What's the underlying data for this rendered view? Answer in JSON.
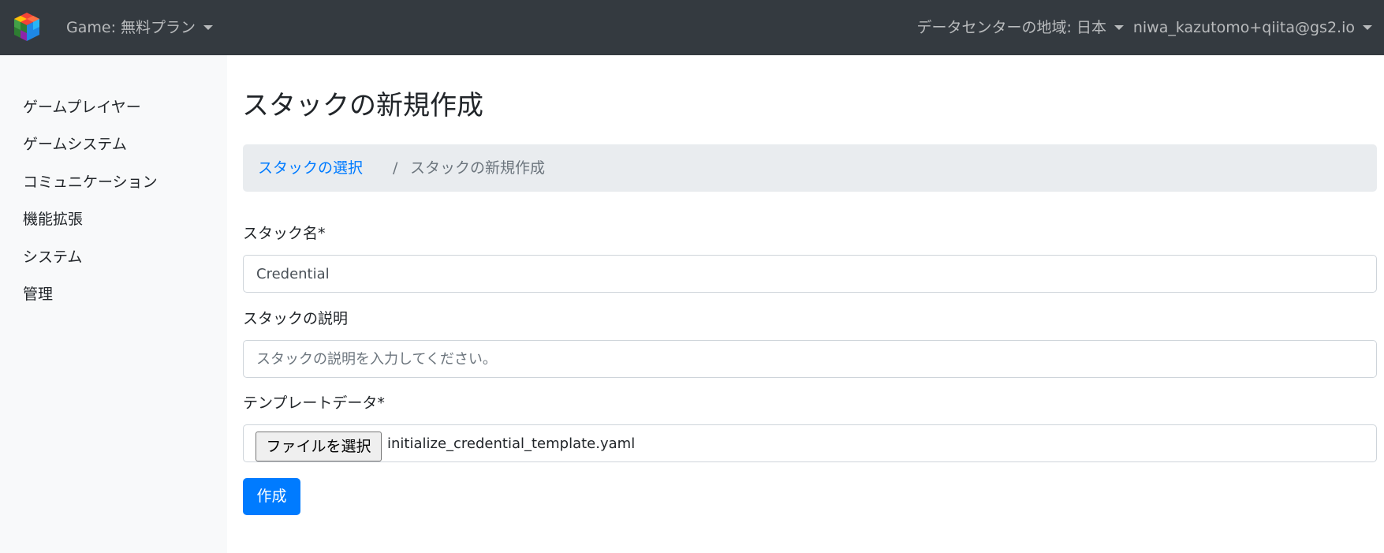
{
  "navbar": {
    "logo_icon": "cube-logo-icon",
    "game_selector": "Game: 無料プラン",
    "region_selector": "データセンターの地域: 日本",
    "user_menu": "niwa_kazutomo+qiita@gs2.io",
    "background_color": "#343a40"
  },
  "sidebar": {
    "items": [
      {
        "label": "ゲームプレイヤー"
      },
      {
        "label": "ゲームシステム"
      },
      {
        "label": "コミュニケーション"
      },
      {
        "label": "機能拡張"
      },
      {
        "label": "システム"
      },
      {
        "label": "管理"
      }
    ]
  },
  "main": {
    "title": "スタックの新規作成",
    "breadcrumb": {
      "link": "スタックの選択",
      "separator": "/",
      "current": "スタックの新規作成"
    },
    "form": {
      "stack_name": {
        "label": "スタック名*",
        "value": "Credential"
      },
      "description": {
        "label": "スタックの説明",
        "value": "",
        "placeholder": "スタックの説明を入力してください。"
      },
      "template": {
        "label": "テンプレートデータ*",
        "button_label": "ファイルを選択",
        "file_name": "initialize_credential_template.yaml"
      },
      "submit_label": "作成"
    }
  },
  "colors": {
    "primary": "#007bff",
    "sidebar_bg": "#f8f9fa",
    "breadcrumb_bg": "#e9ecef"
  }
}
